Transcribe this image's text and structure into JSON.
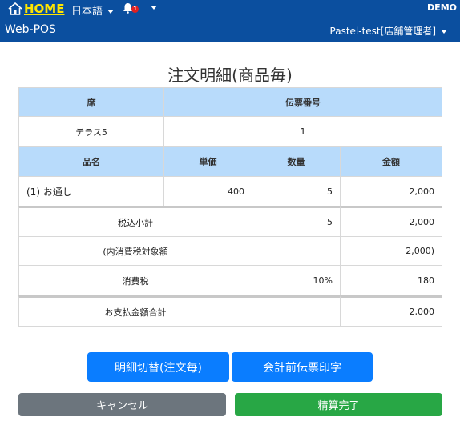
{
  "header": {
    "home_label": "HOME",
    "language_label": "日本語",
    "notification_count": "1",
    "environment_label": "DEMO",
    "app_title": "Web-POS",
    "user_label": "Pastel-test[店舗管理者]"
  },
  "page": {
    "title": "注文明細(商品毎)"
  },
  "table": {
    "seat_header": "席",
    "slip_header": "伝票番号",
    "seat_value": "テラス5",
    "slip_value": "1",
    "item_header": "品名",
    "unit_price_header": "単価",
    "quantity_header": "数量",
    "amount_header": "金額",
    "items": [
      {
        "name": "(1) お通し",
        "unit_price": "400",
        "quantity": "5",
        "amount": "2,000"
      }
    ],
    "subtotal_label": "税込小計",
    "subtotal_quantity": "5",
    "subtotal_amount": "2,000",
    "taxable_label": "(内消費税対象額",
    "taxable_amount": "2,000)",
    "tax_label": "消費税",
    "tax_rate": "10%",
    "tax_amount": "180",
    "total_label": "お支払金額合計",
    "total_amount": "2,000"
  },
  "actions": {
    "switch_detail_label": "明細切替(注文毎)",
    "print_label": "会計前伝票印字",
    "cancel_label": "キャンセル",
    "complete_label": "精算完了"
  },
  "colors": {
    "header_bg": "#0b4f9f",
    "home_text": "#ffe600",
    "table_header_bg": "#b8dbfb",
    "primary": "#0a7dff",
    "secondary": "#6c757d",
    "success": "#28a745"
  },
  "icons": {
    "home": "home-icon",
    "notification": "bell-icon",
    "dropdown": "caret-down-icon"
  }
}
